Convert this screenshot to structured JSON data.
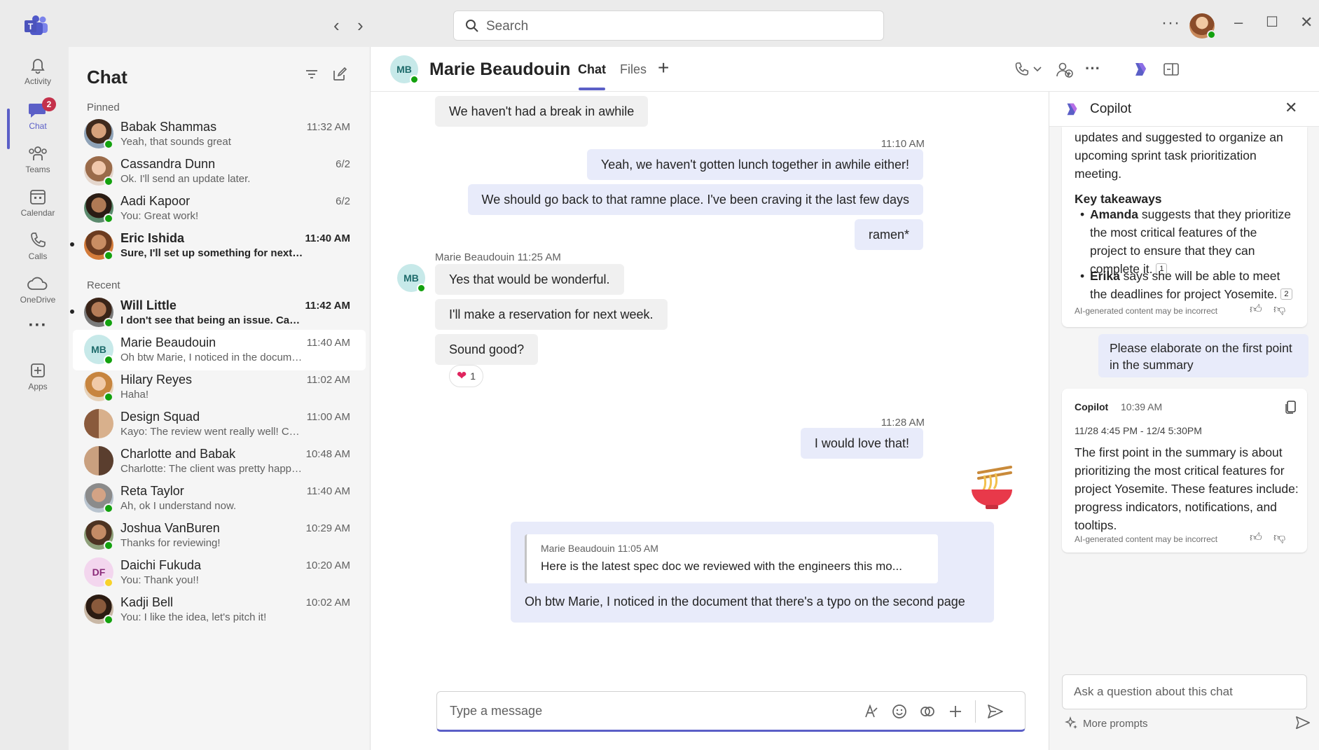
{
  "titlebar": {
    "search_placeholder": "Search",
    "more": "···"
  },
  "rail": {
    "items": [
      {
        "label": "Activity",
        "icon": "bell-icon"
      },
      {
        "label": "Chat",
        "icon": "chat-icon",
        "badge": "2"
      },
      {
        "label": "Teams",
        "icon": "teams-icon"
      },
      {
        "label": "Calendar",
        "icon": "calendar-icon"
      },
      {
        "label": "Calls",
        "icon": "phone-icon"
      },
      {
        "label": "OneDrive",
        "icon": "cloud-icon"
      },
      {
        "label": "···",
        "icon": "more-icon"
      },
      {
        "label": "Apps",
        "icon": "apps-icon"
      }
    ]
  },
  "chatlist": {
    "title": "Chat",
    "pinned_label": "Pinned",
    "recent_label": "Recent",
    "pinned": [
      {
        "name": "Babak Shammas",
        "time": "11:32 AM",
        "preview": "Yeah, that sounds great"
      },
      {
        "name": "Cassandra Dunn",
        "time": "6/2",
        "preview": "Ok. I'll send an update later."
      },
      {
        "name": "Aadi Kapoor",
        "time": "6/2",
        "preview": "You: Great work!"
      },
      {
        "name": "Eric Ishida",
        "time": "11:40 AM",
        "preview": "Sure, I'll set up something for next week t..."
      }
    ],
    "recent": [
      {
        "name": "Will Little",
        "time": "11:42 AM",
        "preview": "I don't see that being an issue. Can you ta..."
      },
      {
        "name": "Marie Beaudouin",
        "time": "11:40 AM",
        "preview": "Oh btw Marie, I noticed in the document t...",
        "initials": "MB"
      },
      {
        "name": "Hilary Reyes",
        "time": "11:02 AM",
        "preview": "Haha!"
      },
      {
        "name": "Design Squad",
        "time": "11:00 AM",
        "preview": "Kayo: The review went really well! Can't wai..."
      },
      {
        "name": "Charlotte and Babak",
        "time": "10:48 AM",
        "preview": "Charlotte: The client was pretty happy with..."
      },
      {
        "name": "Reta Taylor",
        "time": "11:40 AM",
        "preview": "Ah, ok I understand now."
      },
      {
        "name": "Joshua VanBuren",
        "time": "10:29 AM",
        "preview": "Thanks for reviewing!"
      },
      {
        "name": "Daichi Fukuda",
        "time": "10:20 AM",
        "preview": "You: Thank you!!",
        "initials": "DF"
      },
      {
        "name": "Kadji Bell",
        "time": "10:02 AM",
        "preview": "You: I like the idea, let's pitch it!"
      }
    ]
  },
  "conversation": {
    "initials": "MB",
    "name": "Marie Beaudouin",
    "tabs": [
      "Chat",
      "Files"
    ],
    "add_tab": "+",
    "messages": {
      "m1": "We haven't had a break in awhile",
      "t1": "11:10 AM",
      "m2": "Yeah, we haven't gotten lunch together in awhile either!",
      "m3": "We should go back to that ramne place. I've been craving it the last few days",
      "m4": "ramen*",
      "sender_meta": "Marie Beaudouin  11:25 AM",
      "m5": "Yes that would be wonderful.",
      "m6": "I'll make a reservation for next week.",
      "m7": "Sound good?",
      "reaction_count": "1",
      "t2": "11:28 AM",
      "m8": "I would love that!",
      "quote_meta": "Marie Beaudouin  11:05 AM",
      "quote_text": "Here is the latest spec doc we reviewed with the engineers this mo...",
      "m9": "Oh btw Marie, I noticed in the document that there's a typo on the second page"
    },
    "composer_placeholder": "Type a message"
  },
  "copilot": {
    "title": "Copilot",
    "summary_intro": [
      "updates and suggested to organize an",
      "upcoming sprint task prioritization",
      "meeting."
    ],
    "key_takeaways": "Key takeaways",
    "bullet1": {
      "bold": "Amanda",
      "lines": [
        " suggests that they prioritize",
        "the most critical features of the",
        "project to ensure that they can",
        "complete it."
      ],
      "ref": "1"
    },
    "bullet2": {
      "bold": "Erika",
      "lines": [
        " says she will be able to meet",
        "the deadlines for project Yosemite."
      ],
      "ref": "2"
    },
    "disclaimer": "AI-generated content may be incorrect",
    "user_prompt": [
      "Please elaborate on the first point",
      "in the summary"
    ],
    "reply_sender": "Copilot",
    "reply_time": "10:39 AM",
    "reply_range": "11/28 4:45 PM - 12/4 5:30PM",
    "reply_lines": [
      "The first point in the summary is about",
      "prioritizing the most critical features for",
      "project Yosemite. These features include:",
      "progress indicators, notifications, and",
      "tooltips."
    ],
    "ask_placeholder": "Ask a question about this chat",
    "more_prompts": "More prompts"
  },
  "colors": {
    "brand": "#5b5fc7",
    "presence_available": "#13a10e",
    "badge": "#c4314b",
    "bubble_mine": "#e8ebfa"
  }
}
